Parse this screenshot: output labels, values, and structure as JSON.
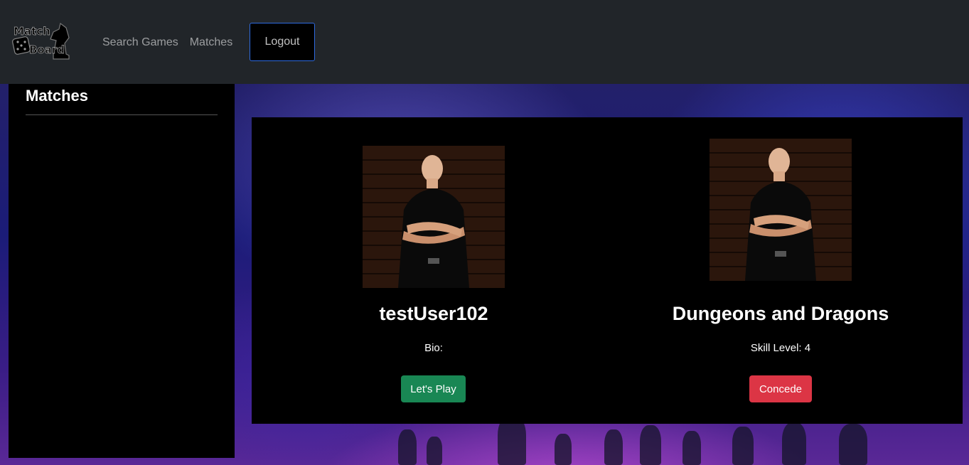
{
  "brand": {
    "logo_line1": "Match",
    "logo_line2": "Board"
  },
  "nav": {
    "links": [
      {
        "label": "Search Games"
      },
      {
        "label": "Matches"
      }
    ],
    "logout_label": "Logout"
  },
  "sidebar": {
    "title": "Matches"
  },
  "match_card": {
    "user": {
      "username": "testUser102",
      "bio_label": "Bio:",
      "action_label": "Let's Play"
    },
    "game": {
      "title": "Dungeons and Dragons",
      "skill_label": "Skill Level: 4",
      "action_label": "Concede"
    }
  },
  "colors": {
    "navbar_bg": "#212529",
    "play_button": "#198754",
    "concede_button": "#dc3545",
    "logout_border": "#2f6be0"
  }
}
